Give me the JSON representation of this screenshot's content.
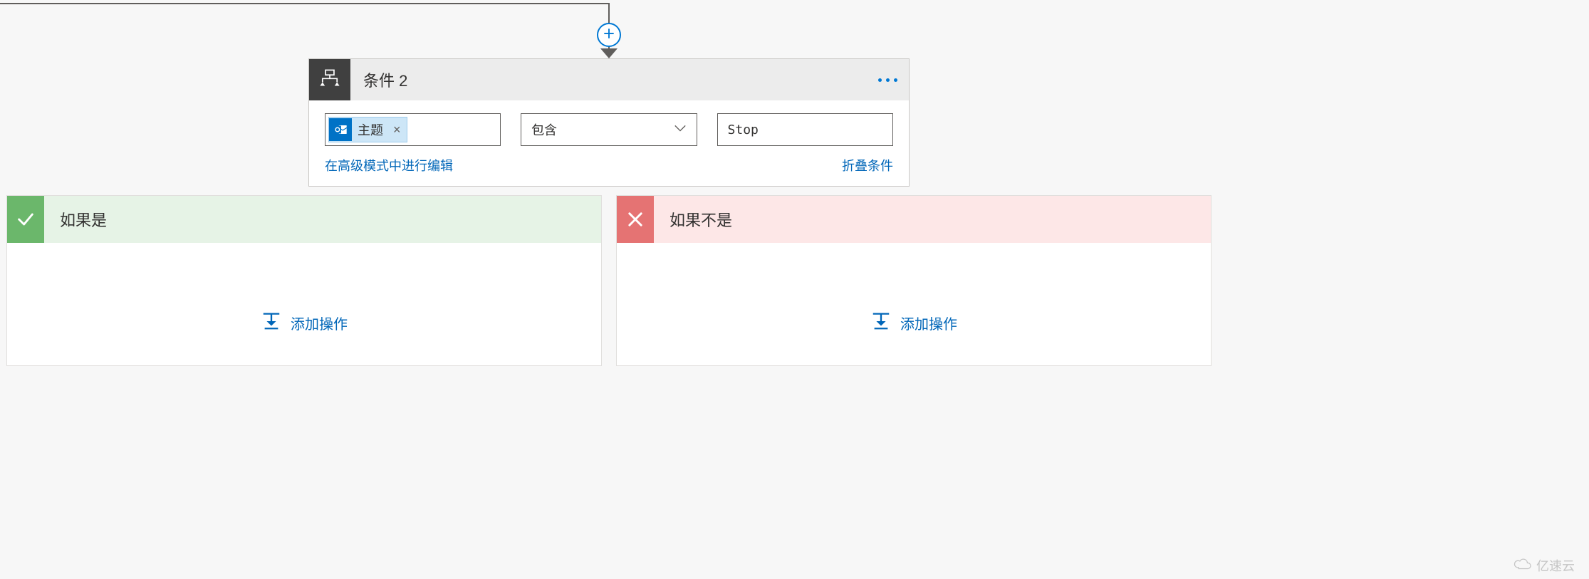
{
  "condition": {
    "title": "条件 2",
    "left_token": {
      "label": "主题",
      "icon": "outlook-icon"
    },
    "operator": "包含",
    "right_value": "Stop",
    "links": {
      "advanced": "在高级模式中进行编辑",
      "collapse": "折叠条件"
    }
  },
  "branches": {
    "yes": {
      "title": "如果是",
      "action_label": "添加操作"
    },
    "no": {
      "title": "如果不是",
      "action_label": "添加操作"
    }
  },
  "watermark": "亿速云",
  "icons": {
    "add": "plus-icon",
    "condition": "condition-icon",
    "chevron_down": "chevron-down-icon",
    "check": "check-icon",
    "cross": "cross-icon",
    "insert": "insert-action-icon",
    "cloud": "cloud-icon"
  },
  "colors": {
    "link": "#0066b8",
    "accent": "#0078d4",
    "yes_bg": "#e6f3e6",
    "no_bg": "#fde7e7",
    "yes_icon": "#6bb76b",
    "no_icon": "#e57373",
    "token_bg": "#cde6f7",
    "outlook": "#0072c6"
  }
}
